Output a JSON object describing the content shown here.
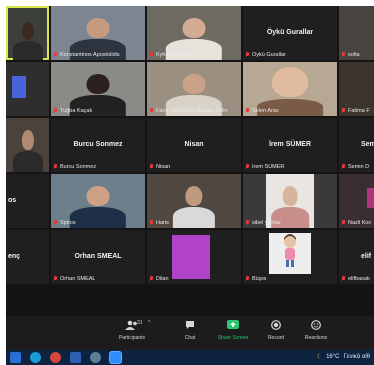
{
  "participants": [
    {
      "id": "p1",
      "label": "",
      "name_display": "",
      "video": true,
      "muted": false,
      "active": true
    },
    {
      "id": "p2",
      "label": "Konstantinos Apostolidis",
      "video": true,
      "muted": true
    },
    {
      "id": "p3",
      "label": "Kyhaki Fokadou",
      "video": true,
      "muted": true
    },
    {
      "id": "p4",
      "label": "Öykü Gurallar",
      "name_display": "Öykü Gurallar",
      "video": false,
      "muted": true
    },
    {
      "id": "p5",
      "label": "sofia",
      "video": true,
      "muted": true
    },
    {
      "id": "p6",
      "label": "",
      "video": true,
      "muted": false
    },
    {
      "id": "p7",
      "label": "Tuğba Kaçak",
      "video": true,
      "muted": true
    },
    {
      "id": "p8",
      "label": "Fana Sahinoğlu Mahisa Sölin",
      "video": true,
      "muted": true
    },
    {
      "id": "p9",
      "label": "Selen Aras",
      "video": true,
      "muted": true
    },
    {
      "id": "p10",
      "label": "Fatima F",
      "video": true,
      "muted": true
    },
    {
      "id": "p11",
      "label": "",
      "video": true,
      "muted": false
    },
    {
      "id": "p12",
      "label": "Burcu Sonmez",
      "name_display": "Burcu Sonmez",
      "video": false,
      "muted": true
    },
    {
      "id": "p13",
      "label": "Nisan",
      "name_display": "Nisan",
      "video": false,
      "muted": true
    },
    {
      "id": "p14",
      "label": "İrem SÜMER",
      "name_display": "İrem SÜMER",
      "video": false,
      "muted": true
    },
    {
      "id": "p15",
      "label": "Semin D",
      "name_display": "Sem",
      "video": false,
      "muted": true
    },
    {
      "id": "p16",
      "label": "",
      "name_display": "os",
      "video": false,
      "muted": false
    },
    {
      "id": "p17",
      "label": "Spiros",
      "video": true,
      "muted": true
    },
    {
      "id": "p18",
      "label": "Haris",
      "video": true,
      "muted": true
    },
    {
      "id": "p19",
      "label": "sibel yılmaz",
      "video": true,
      "muted": true
    },
    {
      "id": "p20",
      "label": "Nazli Koc",
      "video": true,
      "muted": true
    },
    {
      "id": "p21",
      "label": "",
      "name_display": "enç",
      "video": false,
      "muted": false
    },
    {
      "id": "p22",
      "label": "Orhan SMEAL",
      "name_display": "Orhan SMEAL",
      "video": false,
      "muted": true
    },
    {
      "id": "p23",
      "label": "Dilan",
      "video": true,
      "muted": true
    },
    {
      "id": "p24",
      "label": "Büşra",
      "video": true,
      "muted": true
    },
    {
      "id": "p25",
      "label": "elifbasak",
      "name_display": "elif",
      "video": false,
      "muted": true
    }
  ],
  "toolbar": {
    "participants_count": "31",
    "participants_label": "Participants",
    "chat_label": "Chat",
    "share_label": "Share Screen",
    "record_label": "Record",
    "reactions_label": "Reactions"
  },
  "taskbar": {
    "weather": "16°C",
    "weather_desc": "Γενικά αίθ"
  },
  "colors": {
    "share_green": "#29c76f",
    "muted_red": "#e23b3b",
    "active_border": "#d8e64a"
  }
}
